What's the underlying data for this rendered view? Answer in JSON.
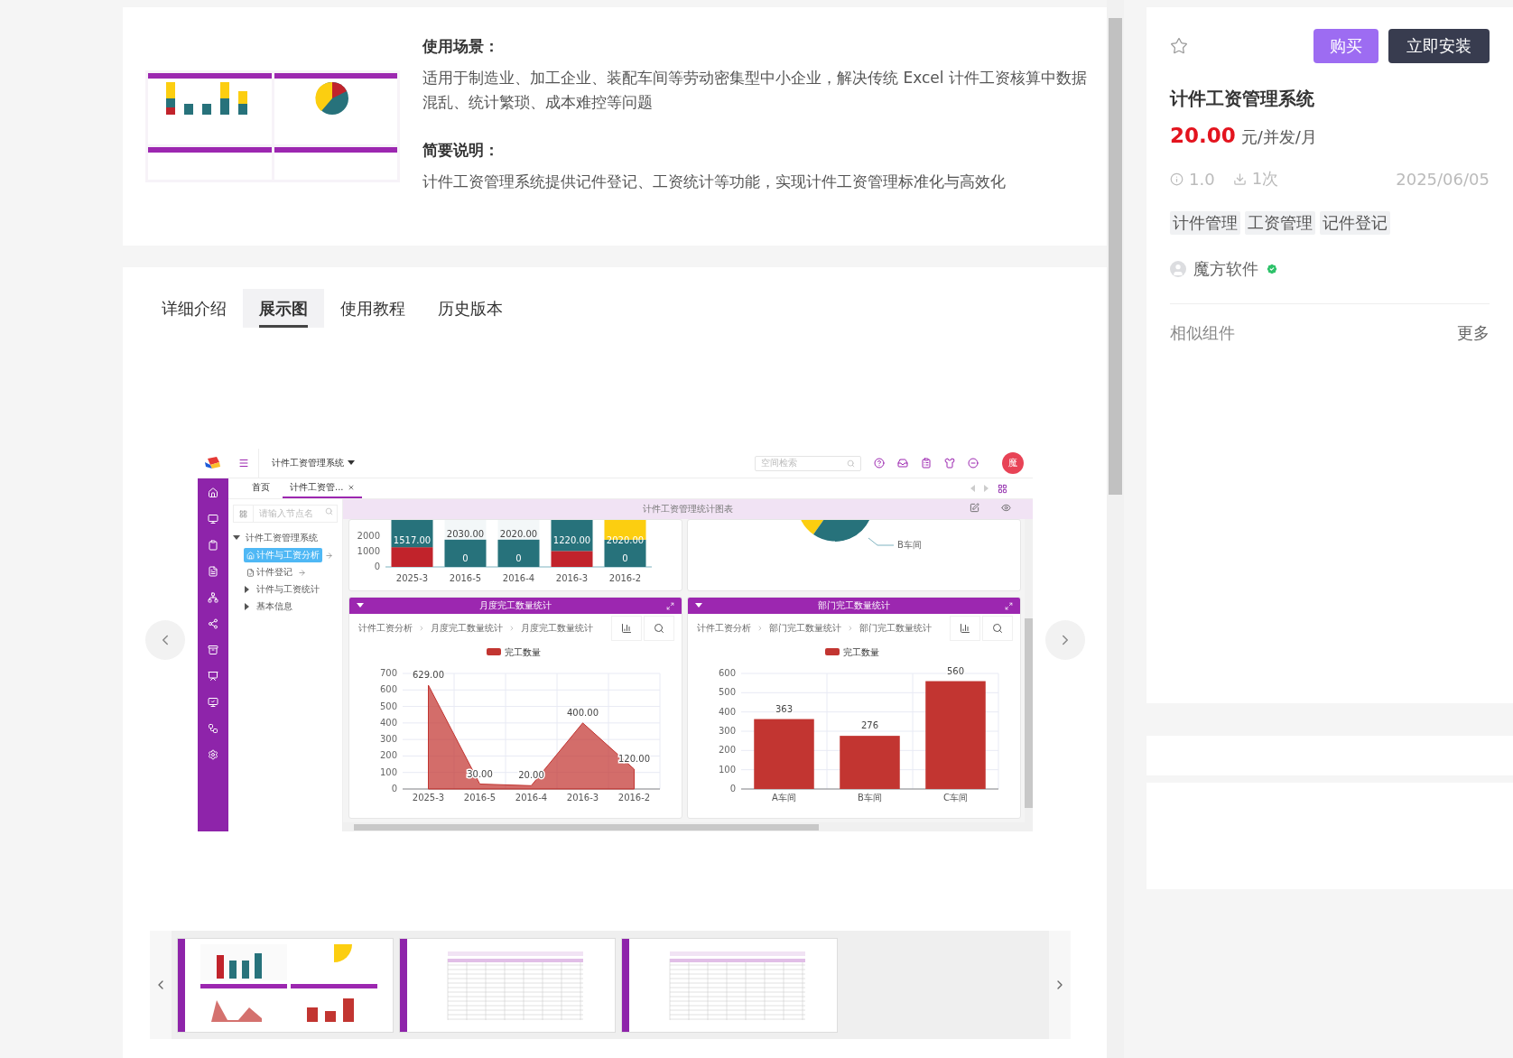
{
  "intro": {
    "sections": [
      {
        "heading": "使用场景：",
        "text": "适用于制造业、加工企业、装配车间等劳动密集型中小企业，解决传统 Excel 计件工资核算中数据混乱、统计繁琐、成本难控等问题"
      },
      {
        "heading": "简要说明：",
        "text": "计件工资管理系统提供记件登记、工资统计等功能，实现计件工资管理标准化与高效化"
      }
    ]
  },
  "tabs": [
    {
      "label": "详细介绍",
      "selected": false
    },
    {
      "label": "展示图",
      "selected": true
    },
    {
      "label": "使用教程",
      "selected": false
    },
    {
      "label": "历史版本",
      "selected": false
    }
  ],
  "showcase": {
    "app": {
      "title": "计件工资管理系统",
      "search_placeholder": "空间检索",
      "avatar": "魔",
      "tabs": [
        {
          "label": "首页",
          "selected": false,
          "closable": false
        },
        {
          "label": "计件工资管...",
          "selected": true,
          "closable": true
        }
      ],
      "tree_search_placeholder": "请输入节点名",
      "tree": [
        {
          "label": "计件工资管理系统",
          "kind": "folder",
          "expanded": true,
          "selected": false,
          "children": [
            {
              "label": "计件与工资分析",
              "kind": "home",
              "selected": true
            },
            {
              "label": "计件登记",
              "kind": "page",
              "selected": false
            },
            {
              "label": "计件与工资统计",
              "kind": "folder",
              "expanded": false,
              "selected": false
            },
            {
              "label": "基本信息",
              "kind": "folder",
              "expanded": false,
              "selected": false
            }
          ]
        }
      ],
      "panel_title": "计件工资管理统计图表",
      "top_bar_chart": {
        "yticks": [
          "2000",
          "1000",
          "0"
        ],
        "bars": [
          {
            "category": "2025-3",
            "labels": [
              "1517.00"
            ],
            "segments": [
              {
                "color": "#c1232b",
                "level": 0.42
              },
              {
                "color": "#27727b",
                "level": 0.58
              }
            ]
          },
          {
            "category": "2016-5",
            "labels": [
              "2030.00",
              "0"
            ],
            "segments": [
              {
                "color": "#27727b",
                "level": 0.58
              }
            ]
          },
          {
            "category": "2016-4",
            "labels": [
              "2020.00",
              "0"
            ],
            "segments": [
              {
                "color": "#27727b",
                "level": 0.58
              }
            ]
          },
          {
            "category": "2016-3",
            "labels": [
              "1220.00"
            ],
            "segments": [
              {
                "color": "#c1232b",
                "level": 0.34
              },
              {
                "color": "#27727b",
                "level": 0.66
              }
            ]
          },
          {
            "category": "2016-2",
            "labels": [
              "2020.00",
              "0"
            ],
            "segments": [
              {
                "color": "#27727b",
                "level": 0.58
              },
              {
                "color": "#fcce10",
                "level": 0.42
              }
            ]
          }
        ]
      },
      "top_pie": {
        "label": "B车间"
      },
      "cards": [
        {
          "title": "月度完工数量统计",
          "breadcrumb": [
            "计件工资分析",
            "月度完工数量统计",
            "月度完工数量统计"
          ],
          "chart_data": {
            "type": "area",
            "categories": [
              "2025-3",
              "2016-5",
              "2016-4",
              "2016-3",
              "2016-2"
            ],
            "series": [
              {
                "name": "完工数量",
                "color": "#c23531",
                "values": [
                  629,
                  30,
                  20,
                  400,
                  120
                ]
              }
            ],
            "ylim": [
              0,
              700
            ],
            "yticks": [
              0,
              100,
              200,
              300,
              400,
              500,
              600,
              700
            ],
            "grid": true,
            "value_labels": [
              "629.00",
              "30.00",
              "20.00",
              "400.00",
              "120.00"
            ]
          }
        },
        {
          "title": "部门完工数量统计",
          "breadcrumb": [
            "计件工资分析",
            "部门完工数量统计",
            "部门完工数量统计"
          ],
          "chart_data": {
            "type": "bar",
            "categories": [
              "A车间",
              "B车间",
              "C车间"
            ],
            "series": [
              {
                "name": "完工数量",
                "color": "#c23531",
                "values": [
                  363,
                  276,
                  560
                ]
              }
            ],
            "ylim": [
              0,
              600
            ],
            "yticks": [
              0,
              100,
              200,
              300,
              400,
              500,
              600
            ],
            "grid": true,
            "value_labels": [
              "363",
              "276",
              "560"
            ]
          }
        }
      ]
    },
    "thumbnails": [
      {
        "kind": "dashboard"
      },
      {
        "kind": "table"
      },
      {
        "kind": "table"
      }
    ]
  },
  "product": {
    "favorite": false,
    "buttons": [
      {
        "label": "购买",
        "kind": "buy"
      },
      {
        "label": "立即安装",
        "kind": "install"
      }
    ],
    "title": "计件工资管理系统",
    "price": "20.00",
    "unit": "元/并发/月",
    "version": "1.0",
    "downloads": "1次",
    "date": "2025/06/05",
    "tags": [
      "计件管理",
      "工资管理",
      "记件登记"
    ],
    "author": "魔方软件",
    "verified": true,
    "similar": {
      "title": "相似组件",
      "more": "更多"
    }
  }
}
